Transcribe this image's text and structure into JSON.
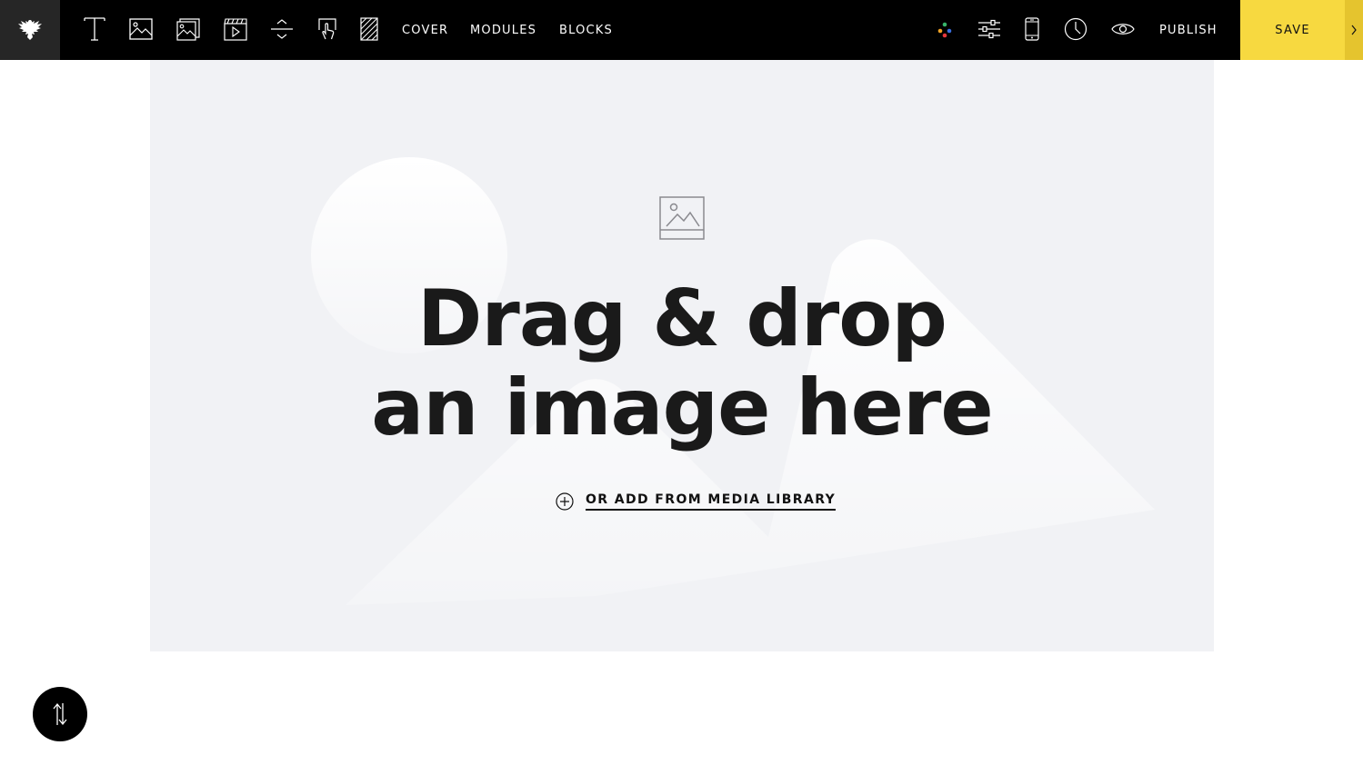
{
  "toolbar": {
    "tools": [
      {
        "icon": "text-icon"
      },
      {
        "icon": "image-icon"
      },
      {
        "icon": "gallery-icon"
      },
      {
        "icon": "video-icon"
      },
      {
        "icon": "spacer-icon"
      },
      {
        "icon": "button-icon"
      },
      {
        "icon": "pattern-icon"
      }
    ],
    "menu": {
      "cover": "COVER",
      "modules": "MODULES",
      "blocks": "BLOCKS"
    },
    "right_icons": [
      "palette-icon",
      "settings-sliders-icon",
      "mobile-icon",
      "history-clock-icon",
      "preview-eye-icon"
    ],
    "publish_label": "PUBLISH",
    "save_label": "SAVE"
  },
  "dropzone": {
    "headline_line1": "Drag & drop",
    "headline_line2": "an image here",
    "media_link": "OR ADD FROM MEDIA LIBRARY"
  },
  "colors": {
    "toolbar_bg": "#000000",
    "logo_bg": "#262626",
    "accent_save": "#f7d940",
    "dropzone_bg": "#f1f2f5"
  }
}
